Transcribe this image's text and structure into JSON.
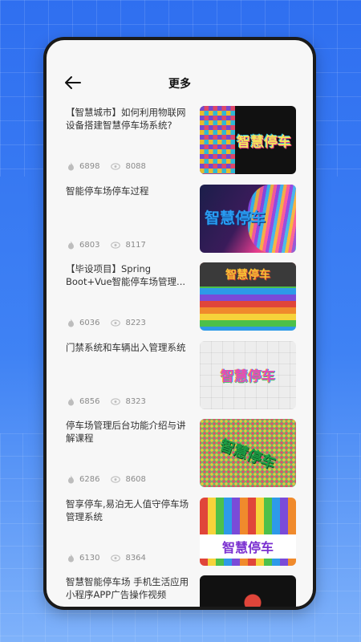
{
  "header": {
    "title": "更多"
  },
  "items": [
    {
      "title": "【智慧城市】如何利用物联网设备搭建智慧停车场系统?",
      "likes": "6898",
      "views": "8088",
      "thumb_label": "智慧停车"
    },
    {
      "title": "智能停车场停车过程",
      "likes": "6803",
      "views": "8117",
      "thumb_label": "智慧停车"
    },
    {
      "title": "【毕设项目】Spring Boot+Vue智能停车场管理...",
      "likes": "6036",
      "views": "8223",
      "thumb_label": "智慧停车"
    },
    {
      "title": "门禁系统和车辆出入管理系统",
      "likes": "6856",
      "views": "8323",
      "thumb_label": "智慧停车"
    },
    {
      "title": "停车场管理后台功能介绍与讲解课程",
      "likes": "6286",
      "views": "8608",
      "thumb_label": "智慧停车"
    },
    {
      "title": "智享停车,易泊无人值守停车场管理系统",
      "likes": "6130",
      "views": "8364",
      "thumb_label": "智慧停车"
    },
    {
      "title": "智慧智能停车场 手机生活应用小程序APP广告操作视频"
    }
  ],
  "icons": {
    "back": "back-arrow-icon",
    "likes": "flame-icon",
    "views": "eye-icon"
  }
}
